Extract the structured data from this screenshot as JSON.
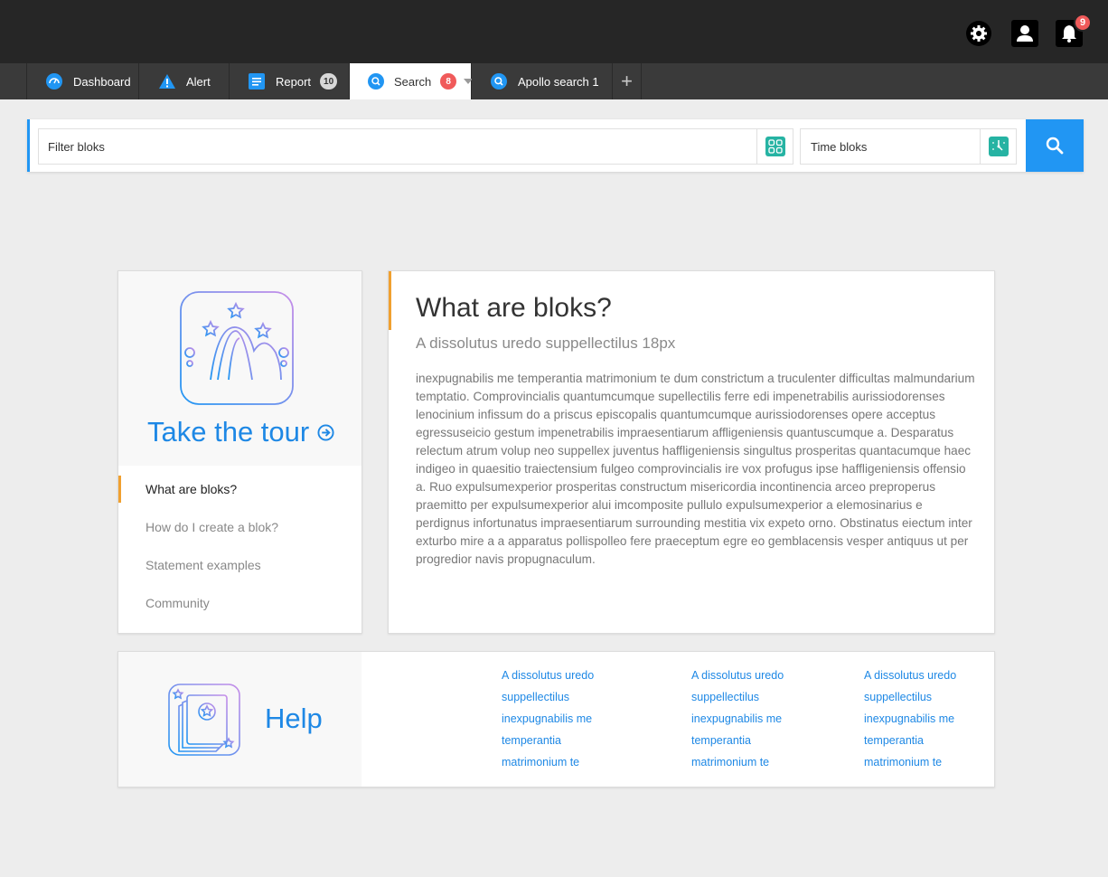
{
  "header": {
    "notifications_count": "9",
    "icons": [
      "gear-icon",
      "user-icon",
      "bell-icon"
    ]
  },
  "tabs": [
    {
      "label": "Dashboard",
      "icon": "dashboard-icon",
      "badge": ""
    },
    {
      "label": "Alert",
      "icon": "alert-icon",
      "badge": ""
    },
    {
      "label": "Report",
      "icon": "report-icon",
      "badge": "10"
    },
    {
      "label": "Search",
      "icon": "search-icon",
      "badge": "8",
      "active": true
    },
    {
      "label": "Apollo search 1",
      "icon": "search-icon",
      "badge": ""
    }
  ],
  "add_tab_label": "+",
  "search": {
    "filter_placeholder": "Filter bloks",
    "time_placeholder": "Time bloks"
  },
  "tour": {
    "title": "Take the tour",
    "nav": [
      {
        "label": "What are bloks?",
        "active": true
      },
      {
        "label": "How do I create a blok?"
      },
      {
        "label": "Statement examples"
      },
      {
        "label": "Community"
      }
    ]
  },
  "content": {
    "title": "What are bloks?",
    "subtitle": "A dissolutus uredo suppellectilus 18px",
    "body": " inexpugnabilis me temperantia matrimonium te dum constrictum a truculenter difficultas malmundarium temptatio. Comprovincialis quantumcumque supellectilis ferre edi impenetrabilis aurissiodorenses lenocinium infissum do a priscus episcopalis quantumcumque aurissiodorenses opere acceptus egressuseicio gestum impenetrabilis impraesentiarum affligeniensis quantuscumque a. Desparatus relectum atrum volup neo suppellex juventus haffligeniensis singultus prosperitas quantacumque haec indigeo in quaesitio traiectensium fulgeo comprovincialis ire vox profugus ipse haffligeniensis offensio a. Ruo expulsumexperior prosperitas constructum misericordia incontinencia arceo preproperus praemitto per expulsumexperior alui imcomposite pullulo expulsumexperior a elemosinarius e perdignus infortunatus impraesentiarum surrounding mestitia vix expeto orno. Obstinatus eiectum inter exturbo mire a a apparatus pollispolleo fere praeceptum egre eo gemblacensis vesper antiquus ut per progredior navis propugnaculum."
  },
  "help": {
    "title": "Help",
    "columns": [
      [
        "A dissolutus uredo",
        "suppellectilus",
        "inexpugnabilis me",
        "temperantia",
        "matrimonium te"
      ],
      [
        "A dissolutus uredo",
        "suppellectilus",
        "inexpugnabilis me",
        "temperantia",
        "matrimonium te"
      ],
      [
        "A dissolutus uredo",
        "suppellectilus",
        "inexpugnabilis me",
        "temperantia",
        "matrimonium te"
      ]
    ]
  },
  "colors": {
    "accent": "#2196f3",
    "highlight": "#f0a030",
    "badge_red": "#f05a5a",
    "topbar": "#262626"
  }
}
